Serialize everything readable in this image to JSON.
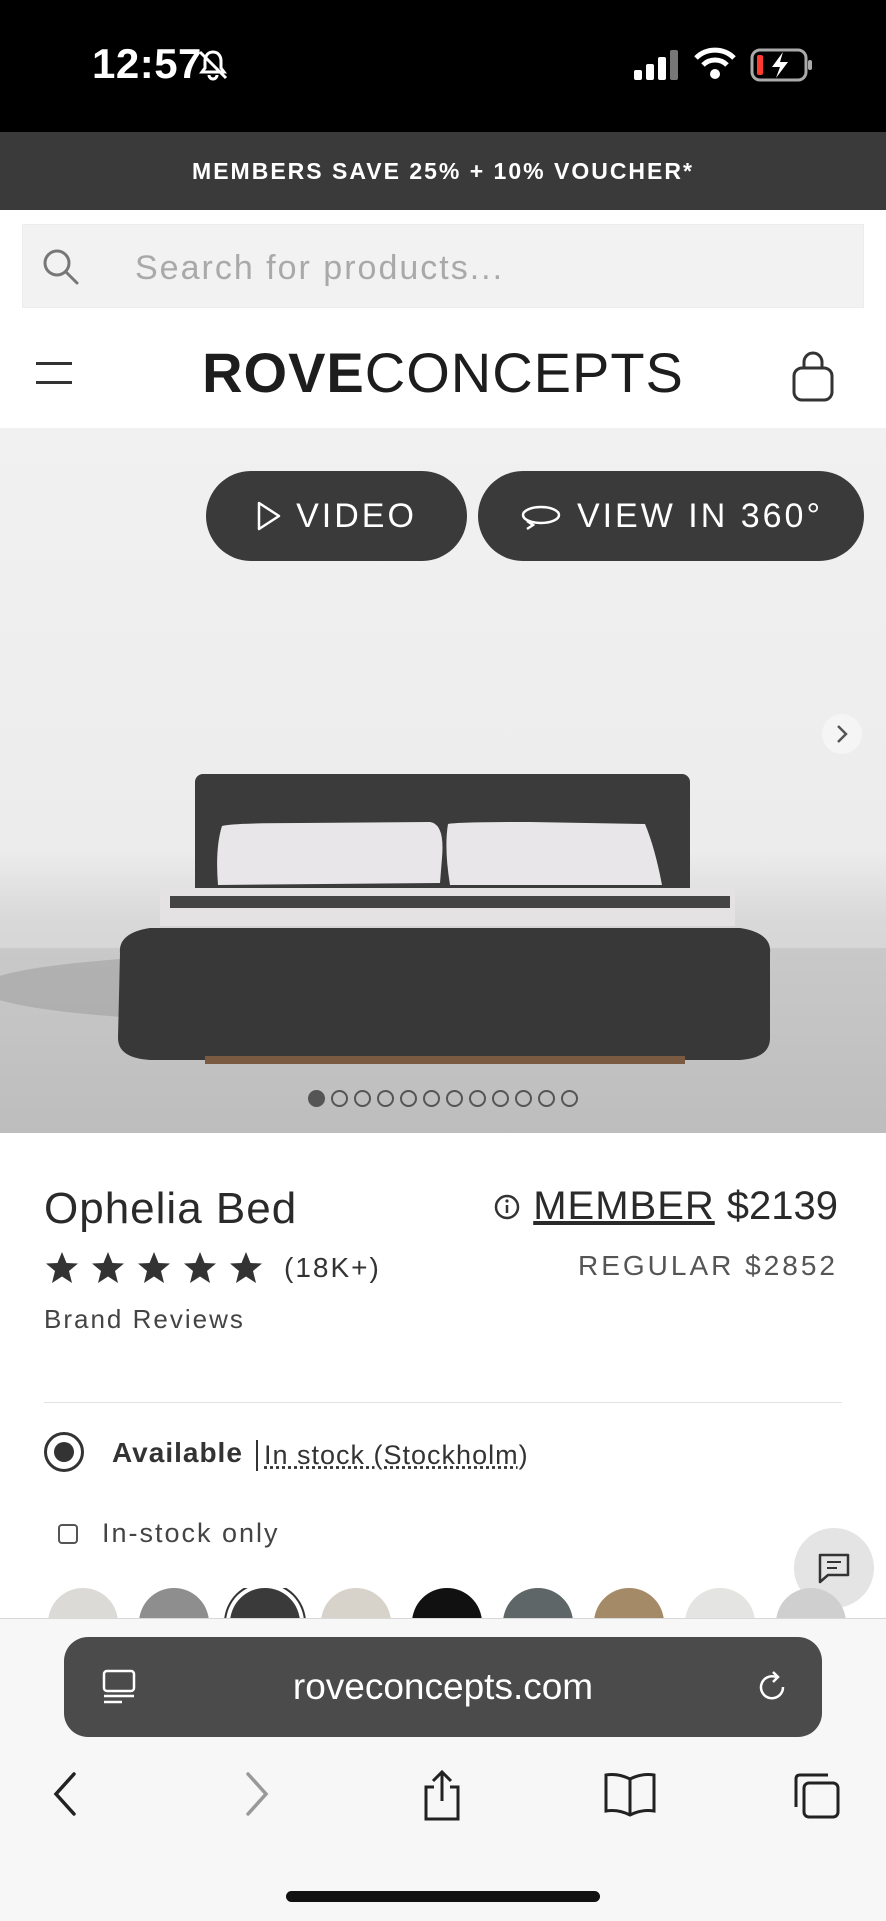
{
  "status_bar": {
    "time": "12:57"
  },
  "promo": {
    "text": "MEMBERS SAVE 25% + 10% VOUCHER*"
  },
  "search": {
    "placeholder": "Search for products..."
  },
  "header": {
    "logo_bold": "ROVE",
    "logo_light": "CONCEPTS"
  },
  "media": {
    "video_label": "VIDEO",
    "view360_label": "VIEW IN 360°",
    "slide_count": 12,
    "active_slide": 1
  },
  "product": {
    "title": "Ophelia Bed",
    "rating_stars": 5,
    "review_count": "(18K+)",
    "brand_reviews": "Brand Reviews",
    "member_label": "MEMBER",
    "member_price": "$2139",
    "regular_price": "REGULAR $2852",
    "availability": "Available",
    "stock_location": "In stock (Stockholm)",
    "instock_filter_label": "In-stock only"
  },
  "swatch_colors": [
    "#dcdad6",
    "#8e8e8e",
    "#3a3a3a",
    "#d7d2ca",
    "#111111",
    "#5f6668",
    "#a58a68",
    "#e4e4e2",
    "#cfcfcf"
  ],
  "browser": {
    "url": "roveconcepts.com"
  }
}
